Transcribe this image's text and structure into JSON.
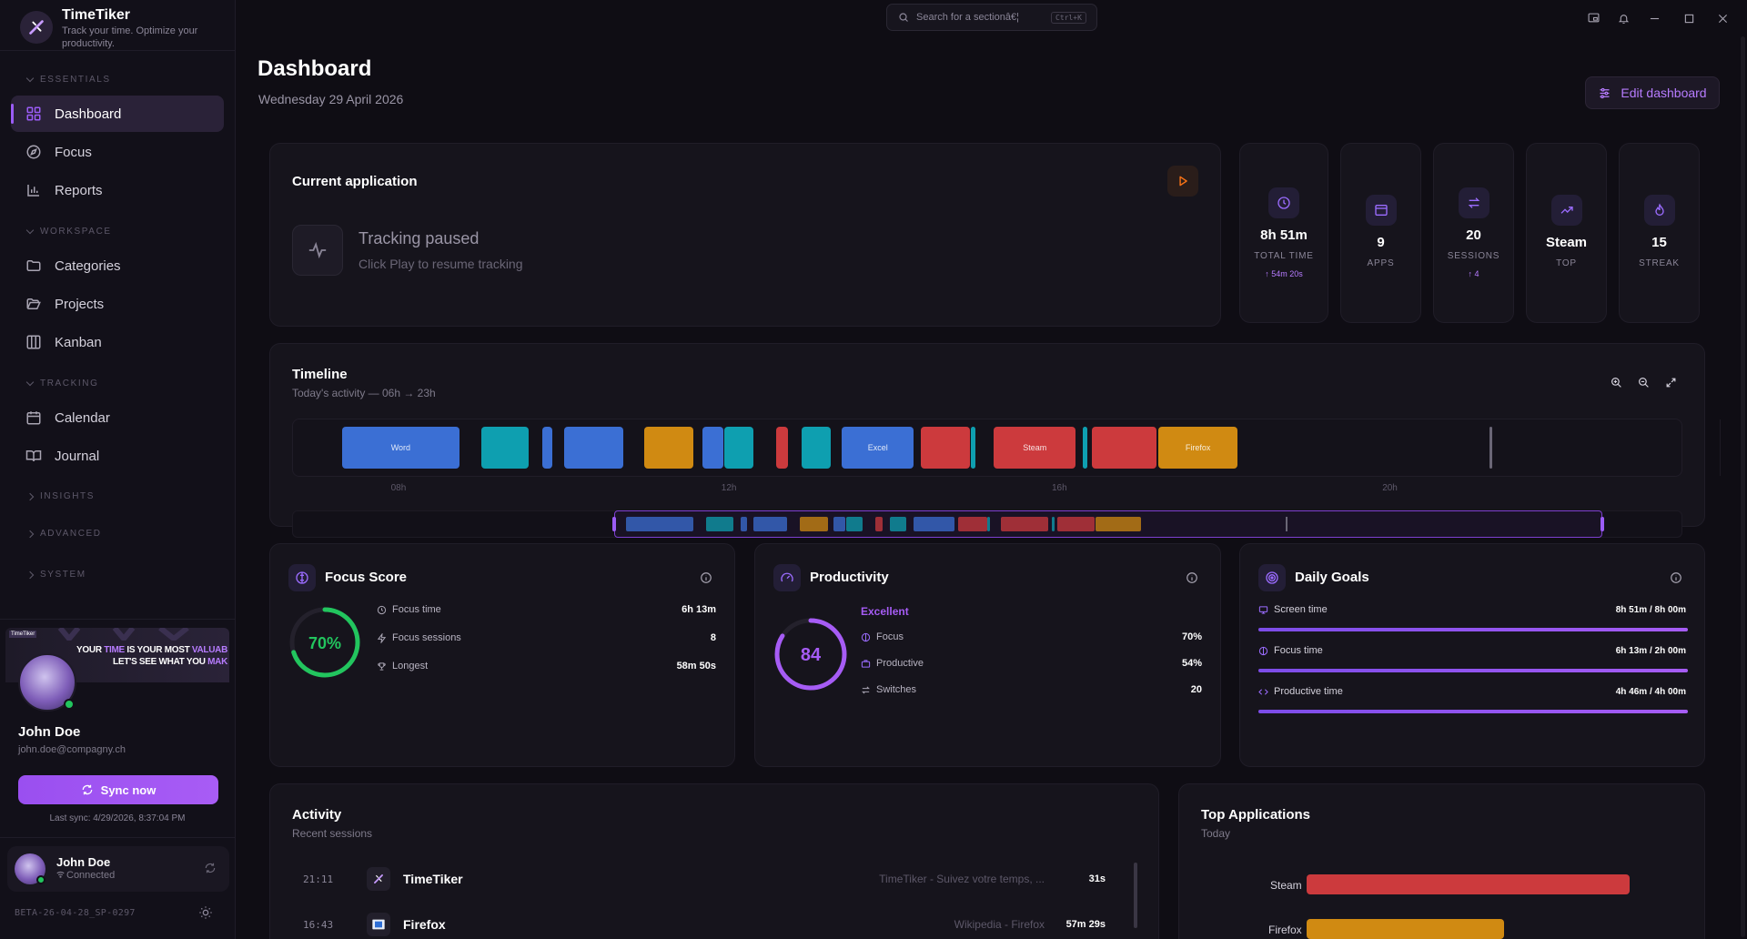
{
  "app": {
    "name": "TimeTiker",
    "tagline": "Track your time. Optimize your productivity."
  },
  "search": {
    "placeholder": "Search for a sectionâ€¦",
    "shortcut": "Ctrl+K"
  },
  "sidebar": {
    "essentials_label": "ESSENTIALS",
    "workspace_label": "WORKSPACE",
    "tracking_label": "TRACKING",
    "insights_label": "INSIGHTS",
    "advanced_label": "ADVANCED",
    "system_label": "SYSTEM",
    "items": {
      "dashboard": "Dashboard",
      "focus": "Focus",
      "reports": "Reports",
      "categories": "Categories",
      "projects": "Projects",
      "kanban": "Kanban",
      "calendar": "Calendar",
      "journal": "Journal"
    }
  },
  "promo": {
    "line1_a": "YOUR ",
    "line1_b": "TIME",
    "line1_c": " IS YOUR MOST ",
    "line1_d": "VALUAB",
    "line2_a": "LET'S SEE",
    "line2_b": " WHAT YOU ",
    "line2_c": "MAK"
  },
  "user": {
    "name": "John Doe",
    "email": "john.doe@compagny.ch",
    "sync_label": "Sync now",
    "last_sync": "Last sync: 4/29/2026, 8:37:04 PM",
    "status": "Connected"
  },
  "version": "BETA-26-04-28_SP-0297",
  "header": {
    "title": "Dashboard",
    "date": "Wednesday 29 April 2026",
    "edit_label": "Edit dashboard"
  },
  "current_app": {
    "title": "Current application",
    "status": "Tracking paused",
    "hint": "Click Play to resume tracking"
  },
  "stats": [
    {
      "value": "8h 51m",
      "label": "TOTAL TIME",
      "delta": "54m 20s"
    },
    {
      "value": "9",
      "label": "APPS"
    },
    {
      "value": "20",
      "label": "SESSIONS",
      "delta": "4"
    },
    {
      "value": "Steam",
      "label": "TOP"
    },
    {
      "value": "15",
      "label": "STREAK"
    }
  ],
  "timeline": {
    "title": "Timeline",
    "subtitle": "Today's activity — 06h → 23h",
    "ticks": [
      "08h",
      "12h",
      "16h",
      "20h"
    ],
    "blocks": [
      {
        "label": "Word",
        "start": 7.31,
        "end": 8.73,
        "color": "#3b6fd4"
      },
      {
        "label": "",
        "start": 9.0,
        "end": 9.57,
        "color": "#0e9fb0"
      },
      {
        "label": "",
        "start": 9.73,
        "end": 9.86,
        "color": "#3b6fd4"
      },
      {
        "label": "",
        "start": 10.0,
        "end": 10.71,
        "color": "#3b6fd4"
      },
      {
        "label": "",
        "start": 10.97,
        "end": 11.56,
        "color": "#d08a12"
      },
      {
        "label": "",
        "start": 11.67,
        "end": 11.92,
        "color": "#3b6fd4"
      },
      {
        "label": "",
        "start": 11.94,
        "end": 12.29,
        "color": "#0e9fb0"
      },
      {
        "label": "",
        "start": 12.56,
        "end": 12.71,
        "color": "#cc3a3d"
      },
      {
        "label": "",
        "start": 12.87,
        "end": 13.22,
        "color": "#0e9fb0"
      },
      {
        "label": "Excel",
        "start": 13.36,
        "end": 14.23,
        "color": "#3b6fd4"
      },
      {
        "label": "",
        "start": 14.31,
        "end": 14.91,
        "color": "#cc3a3d"
      },
      {
        "label": "",
        "start": 14.92,
        "end": 14.98,
        "color": "#0e9fb0"
      },
      {
        "label": "Steam",
        "start": 15.2,
        "end": 16.19,
        "color": "#cc3a3d"
      },
      {
        "label": "",
        "start": 16.27,
        "end": 16.33,
        "color": "#0e9fb0"
      },
      {
        "label": "",
        "start": 16.39,
        "end": 17.17,
        "color": "#cc3a3d"
      },
      {
        "label": "Firefox",
        "start": 17.19,
        "end": 18.15,
        "color": "#d08a12"
      }
    ],
    "now": 21.2
  },
  "focus_score": {
    "title": "Focus Score",
    "percent": 70,
    "percent_label": "70%",
    "rows": [
      {
        "label": "Focus time",
        "value": "6h 13m"
      },
      {
        "label": "Focus sessions",
        "value": "8"
      },
      {
        "label": "Longest",
        "value": "58m 50s"
      }
    ]
  },
  "productivity": {
    "title": "Productivity",
    "score": 84,
    "score_label": "84",
    "rating": "Excellent",
    "rows": [
      {
        "label": "Focus",
        "value": "70%"
      },
      {
        "label": "Productive",
        "value": "54%"
      },
      {
        "label": "Switches",
        "value": "20"
      }
    ]
  },
  "daily_goals": {
    "title": "Daily Goals",
    "goals": [
      {
        "label": "Screen time",
        "value": "8h 51m / 8h 00m",
        "progress": 1.0
      },
      {
        "label": "Focus time",
        "value": "6h 13m / 2h 00m",
        "progress": 1.0
      },
      {
        "label": "Productive time",
        "value": "4h 46m / 4h 00m",
        "progress": 1.0
      }
    ]
  },
  "activity": {
    "title": "Activity",
    "subtitle": "Recent sessions",
    "rows": [
      {
        "time": "21:11",
        "app": "TimeTiker",
        "window": "TimeTiker - Suivez votre temps, ...",
        "duration": "31s"
      },
      {
        "time": "16:43",
        "app": "Firefox",
        "window": "Wikipedia - Firefox",
        "duration": "57m 29s"
      }
    ]
  },
  "top_apps": {
    "title": "Top Applications",
    "subtitle": "Today",
    "apps": [
      {
        "name": "Steam",
        "share": 1.0,
        "color": "#cc3a3d"
      },
      {
        "name": "Firefox",
        "share": 0.61,
        "color": "#d08a12"
      }
    ]
  },
  "colors": {
    "accent": "#9b5cf6",
    "focus_ring": "#22c55e",
    "productivity_ring": "#a65cf5",
    "play": "#f97316"
  }
}
